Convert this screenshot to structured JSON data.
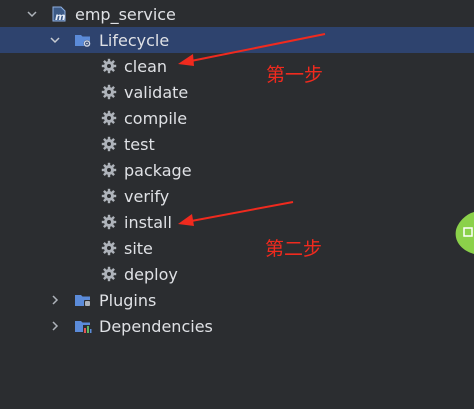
{
  "project": {
    "name": "emp_service",
    "icon": "maven-module-icon"
  },
  "lifecycle": {
    "label": "Lifecycle",
    "icon": "lifecycle-folder-icon",
    "phases": [
      {
        "label": "clean",
        "icon": "gear-icon"
      },
      {
        "label": "validate",
        "icon": "gear-icon"
      },
      {
        "label": "compile",
        "icon": "gear-icon"
      },
      {
        "label": "test",
        "icon": "gear-icon"
      },
      {
        "label": "package",
        "icon": "gear-icon"
      },
      {
        "label": "verify",
        "icon": "gear-icon"
      },
      {
        "label": "install",
        "icon": "gear-icon"
      },
      {
        "label": "site",
        "icon": "gear-icon"
      },
      {
        "label": "deploy",
        "icon": "gear-icon"
      }
    ]
  },
  "plugins": {
    "label": "Plugins",
    "icon": "plugins-folder-icon"
  },
  "dependencies": {
    "label": "Dependencies",
    "icon": "dependencies-folder-icon"
  },
  "annotations": {
    "step1": "第一步",
    "step2": "第二步"
  },
  "colors": {
    "background": "#2b2d30",
    "selection": "#2e436e",
    "text": "#dfe1e5",
    "annotation_red": "#f02a1e",
    "folder_blue": "#5b8bd9"
  }
}
